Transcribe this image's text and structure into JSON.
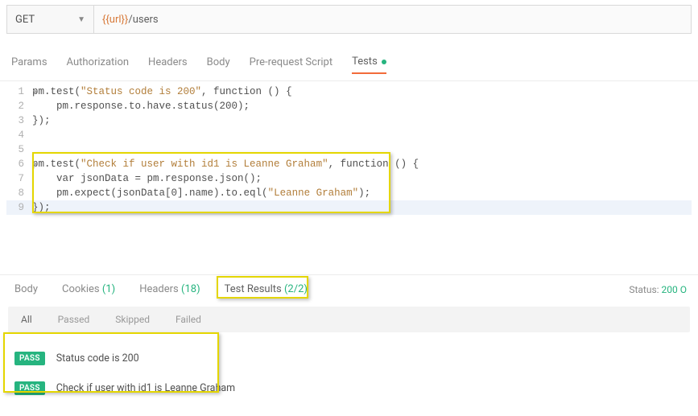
{
  "request": {
    "method": "GET",
    "url_var": "{{url}}",
    "url_path": "/users"
  },
  "reqTabs": {
    "params": "Params",
    "authorization": "Authorization",
    "headers": "Headers",
    "body": "Body",
    "prerequest": "Pre-request Script",
    "tests": "Tests"
  },
  "code": {
    "l1": "pm.test(\"Status code is 200\", function () {",
    "l1s": "\"Status code is 200\"",
    "l2": "    pm.response.to.have.status(200);",
    "l3": "});",
    "l4": "",
    "l5": "",
    "l6": "pm.test(\"Check if user with id1 is Leanne Graham\", function () {",
    "l6s": "\"Check if user with id1 is Leanne Graham\"",
    "l7": "    var jsonData = pm.response.json();",
    "l8": "    pm.expect(jsonData[0].name).to.eql(\"Leanne Graham\");",
    "l8s": "\"Leanne Graham\"",
    "l9": "});"
  },
  "lineNums": {
    "n1": "1",
    "n2": "2",
    "n3": "3",
    "n4": "4",
    "n5": "5",
    "n6": "6",
    "n7": "7",
    "n8": "8",
    "n9": "9"
  },
  "resp": {
    "body": "Body",
    "cookies": "Cookies",
    "cookiesCount": "(1)",
    "headers": "Headers",
    "headersCount": "(18)",
    "testResults": "Test Results",
    "testResultsCount": "(2/2)",
    "statusLabel": "Status:",
    "statusValue": "200 O"
  },
  "filters": {
    "all": "All",
    "passed": "Passed",
    "skipped": "Skipped",
    "failed": "Failed"
  },
  "results": [
    {
      "badge": "PASS",
      "name": "Status code is 200"
    },
    {
      "badge": "PASS",
      "name": "Check if user with id1 is Leanne Graham"
    }
  ]
}
